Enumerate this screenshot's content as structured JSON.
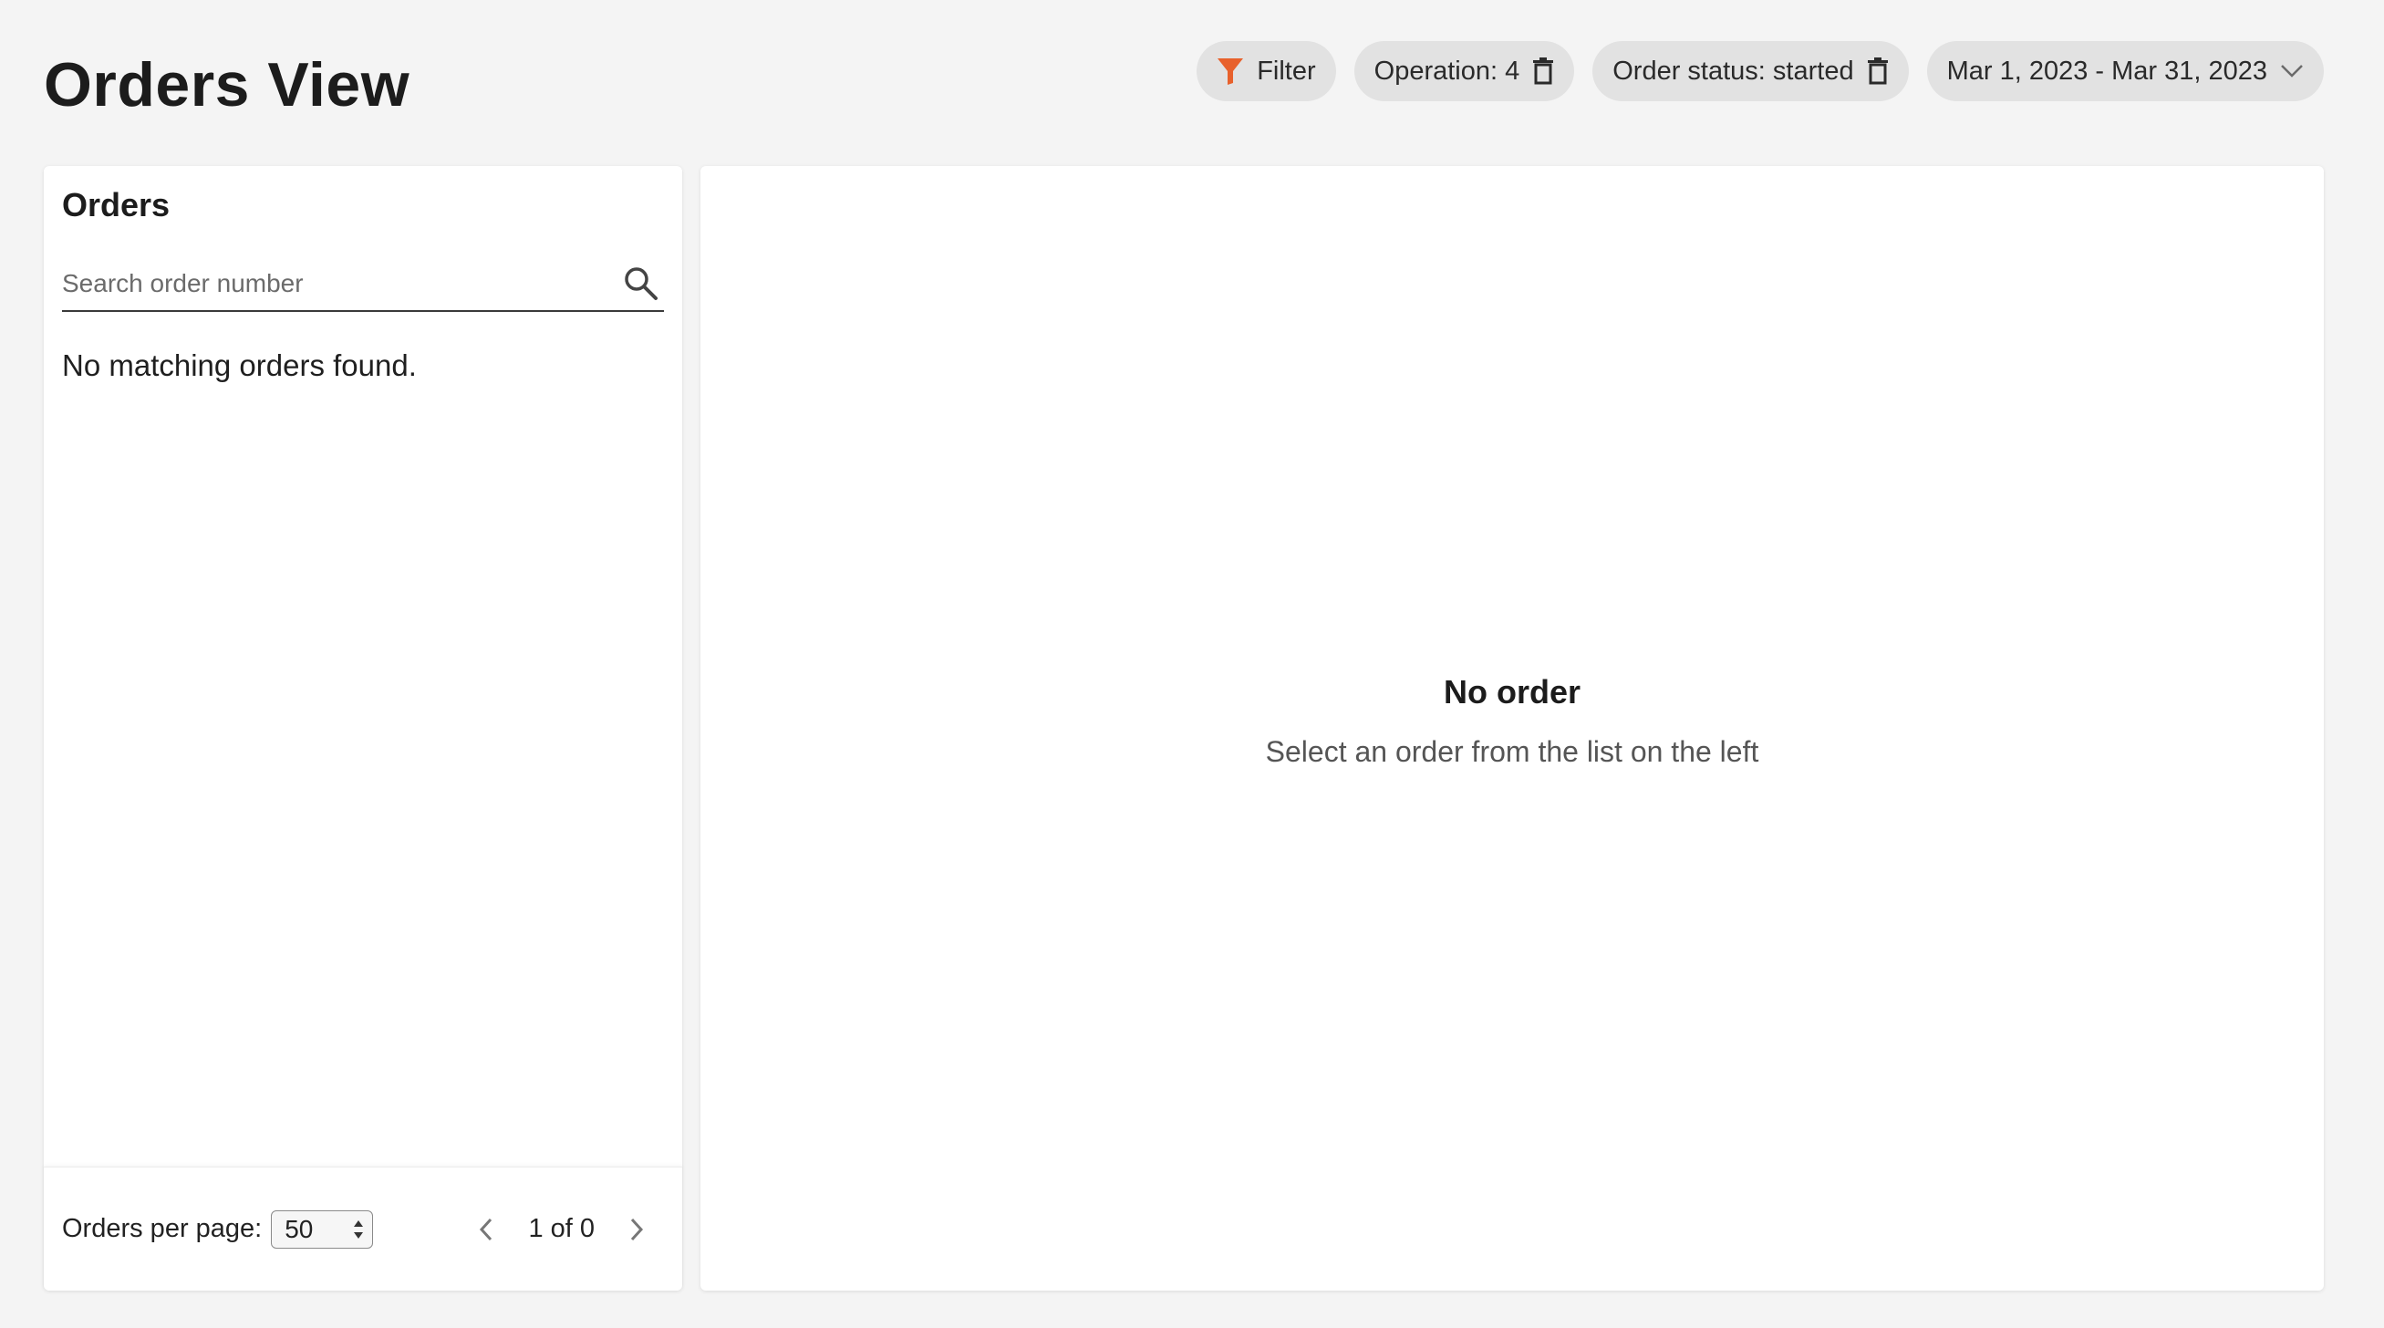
{
  "page": {
    "title": "Orders View"
  },
  "filters": {
    "filter_label": "Filter",
    "operation_label": "Operation: 4",
    "status_label": "Order status: started",
    "date_range_label": "Mar 1, 2023 - Mar 31, 2023",
    "accent_color": "#e8612c"
  },
  "orders": {
    "title": "Orders",
    "search": {
      "placeholder": "Search order number",
      "value": ""
    },
    "empty_message": "No matching orders found.",
    "footer": {
      "per_page_label": "Orders per page:",
      "per_page_value": "50",
      "page_indicator": "1 of 0"
    }
  },
  "detail": {
    "empty_title": "No order",
    "empty_subtitle": "Select an order from the list on the left"
  }
}
